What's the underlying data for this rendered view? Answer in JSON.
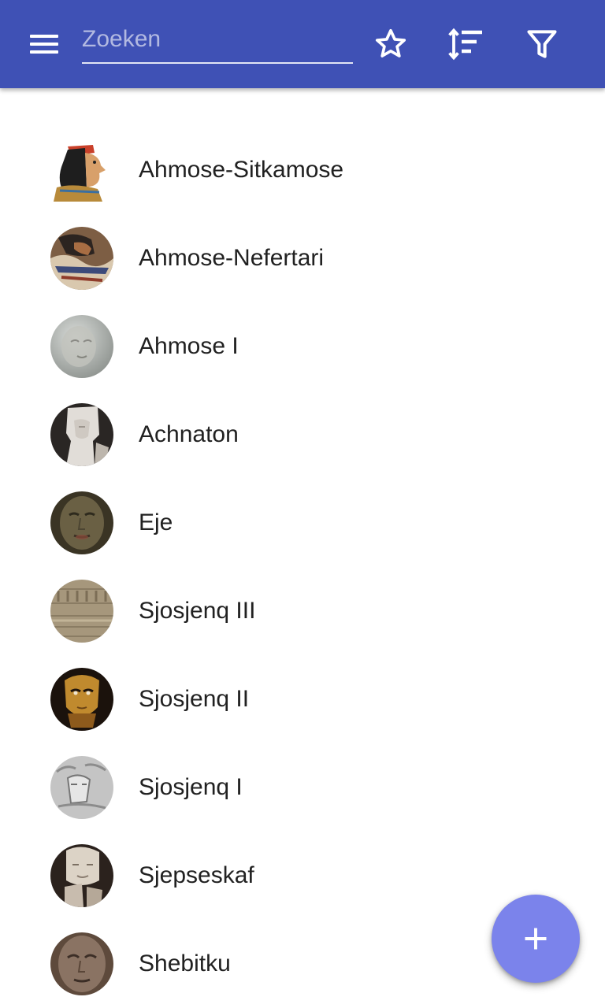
{
  "toolbar": {
    "search_placeholder": "Zoeken",
    "icons": [
      "menu-icon",
      "star-icon",
      "sort-icon",
      "filter-icon"
    ],
    "background": "#3f51b5"
  },
  "items": [
    {
      "label": "Ahmose-Sitkamose",
      "avatar": "portrait-profile-icon",
      "color": "#c9a06a"
    },
    {
      "label": "Ahmose-Nefertari",
      "avatar": "painting-icon",
      "color": "#8a6a4a"
    },
    {
      "label": "Ahmose I",
      "avatar": "stone-head-icon",
      "color": "#b8b8b3"
    },
    {
      "label": "Achnaton",
      "avatar": "statue-icon",
      "color": "#d9d6d2"
    },
    {
      "label": "Eje",
      "avatar": "stone-head-icon",
      "color": "#5a5238"
    },
    {
      "label": "Sjosjenq III",
      "avatar": "relief-icon",
      "color": "#a7977d"
    },
    {
      "label": "Sjosjenq II",
      "avatar": "gold-mask-icon",
      "color": "#b7852e"
    },
    {
      "label": "Sjosjenq I",
      "avatar": "relief-icon",
      "color": "#b9b9b9"
    },
    {
      "label": "Sjepseskaf",
      "avatar": "statue-icon",
      "color": "#d8cfc3"
    },
    {
      "label": "Shebitku",
      "avatar": "stone-head-icon",
      "color": "#7a6150"
    }
  ],
  "fab": {
    "icon": "plus-icon",
    "color": "#7b83eb"
  }
}
